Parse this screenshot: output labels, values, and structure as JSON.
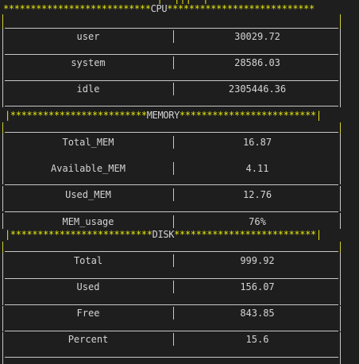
{
  "top_fragment": "|  |||  |",
  "sections": [
    {
      "title": "CPU",
      "header_text": "***************************CPU***************************",
      "rows": [
        {
          "label": "user",
          "value": "30029.72"
        },
        {
          "label": "system",
          "value": "28586.03"
        },
        {
          "label": "idle",
          "value": "2305446.36"
        }
      ]
    },
    {
      "title": "MEMORY",
      "header_text": "|*************************MEMORY*************************|",
      "rows": [
        {
          "label": "Total_MEM",
          "value": "16.87"
        },
        {
          "label": "Available_MEM",
          "value": "4.11"
        },
        {
          "label": "Used_MEM",
          "value": "12.76"
        },
        {
          "label": "MEM_usage",
          "value": "76%"
        }
      ]
    },
    {
      "title": "DISK",
      "header_text": "|**************************DISK**************************|",
      "rows": [
        {
          "label": "Total",
          "value": "999.92"
        },
        {
          "label": "Used",
          "value": "156.07"
        },
        {
          "label": "Free",
          "value": "843.85"
        },
        {
          "label": "Percent",
          "value": "15.6"
        }
      ]
    }
  ],
  "colors": {
    "background": "#1e1e1e",
    "text": "#d4d4d4",
    "stars": "#e5e510",
    "rule": "#c8c8c8"
  }
}
